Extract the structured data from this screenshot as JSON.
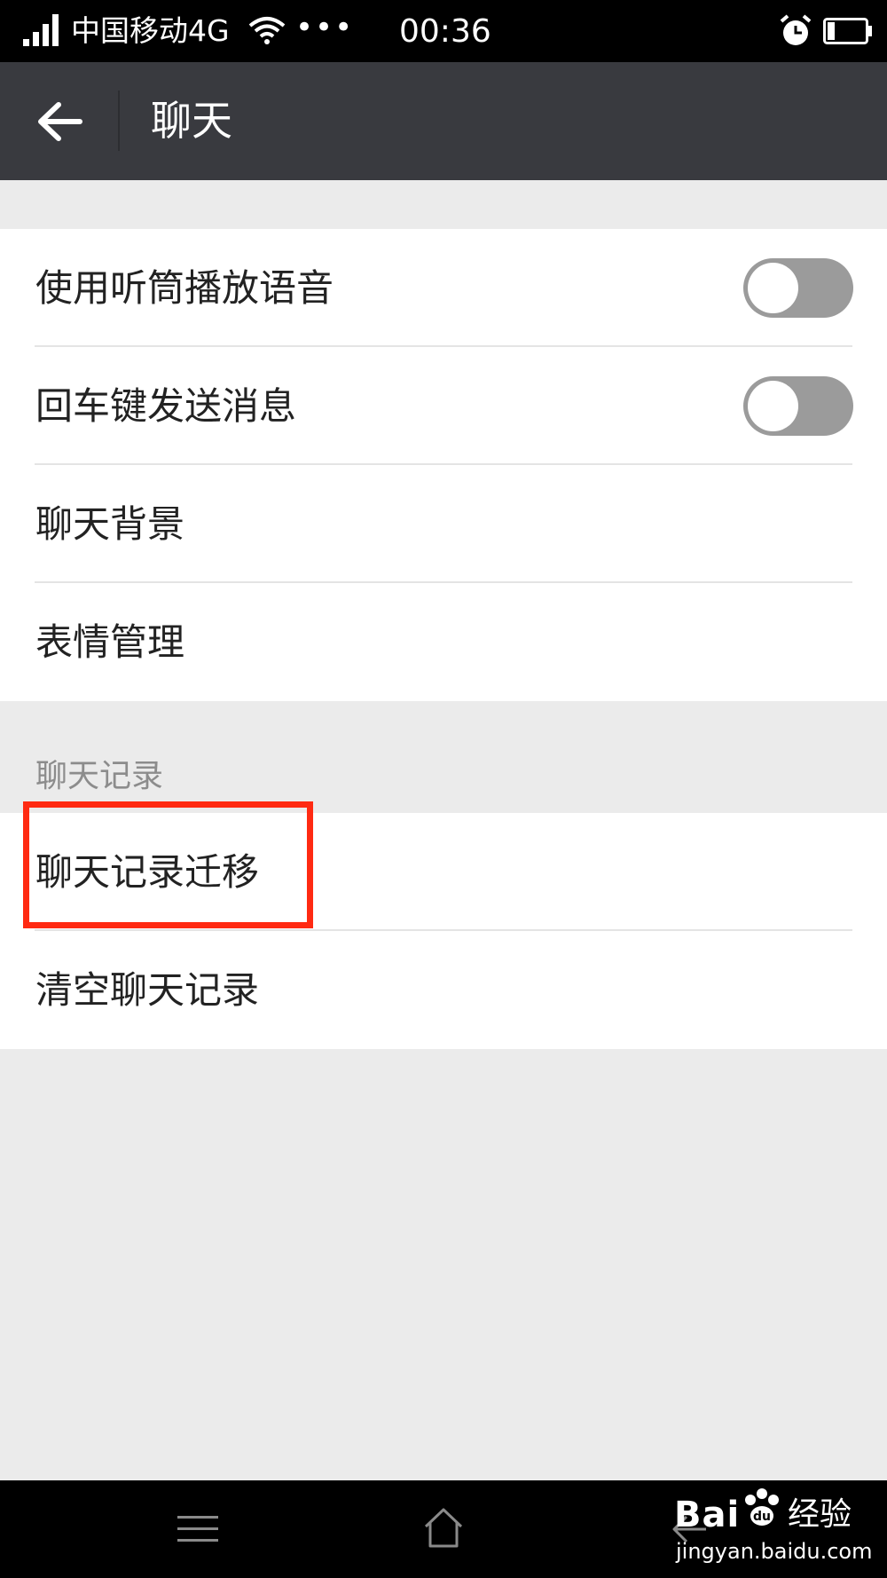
{
  "status_bar": {
    "carrier": "中国移动4G",
    "dots": "•••",
    "time": "00:36"
  },
  "app_bar": {
    "title": "聊天"
  },
  "settings": {
    "general": [
      {
        "label": "使用听筒播放语音",
        "toggle": false
      },
      {
        "label": "回车键发送消息",
        "toggle": false
      },
      {
        "label": "聊天背景"
      },
      {
        "label": "表情管理"
      }
    ],
    "history_header": "聊天记录",
    "history": [
      {
        "label": "聊天记录迁移"
      },
      {
        "label": "清空聊天记录"
      }
    ]
  },
  "watermark": {
    "brand_left": "Bai",
    "brand_right": "经验",
    "url": "jingyan.baidu.com"
  },
  "colors": {
    "app_bar": "#393a3f",
    "background": "#ebebeb",
    "toggle_off": "#9b9b9b",
    "highlight": "#ff2a12"
  }
}
